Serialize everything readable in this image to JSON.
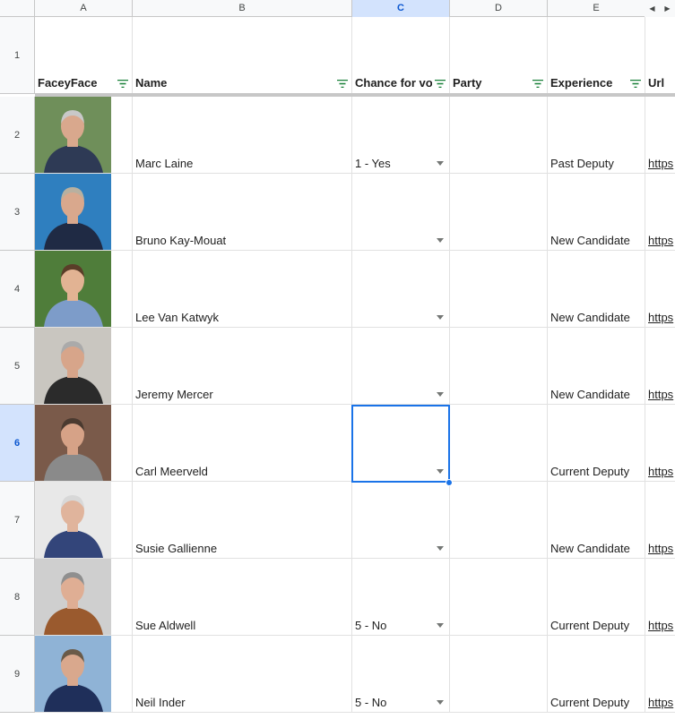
{
  "columns": [
    "A",
    "B",
    "C",
    "D",
    "E",
    ""
  ],
  "selected_column": "C",
  "selected_row": "6",
  "header_row": {
    "number": "1",
    "cells": [
      "FaceyFace",
      "Name",
      "Chance for vo",
      "Party",
      "Experience",
      "Url"
    ]
  },
  "rows": [
    {
      "number": "2",
      "name": "Marc Laine",
      "chance": "1 - Yes",
      "party": "",
      "experience": "Past Deputy",
      "url": "https",
      "photo_bg": "#6f8f5a",
      "photo_skin": "#d9a88d",
      "photo_clothes": "#2e3a55",
      "photo_hair": "#c8c8c8"
    },
    {
      "number": "3",
      "name": "Bruno Kay-Mouat",
      "chance": "",
      "party": "",
      "experience": "New Candidate",
      "url": "https",
      "photo_bg": "#2f7fbf",
      "photo_skin": "#d9a88d",
      "photo_clothes": "#1f2a44",
      "photo_hair": "#b8b0a0"
    },
    {
      "number": "4",
      "name": "Lee Van Katwyk",
      "chance": "",
      "party": "",
      "experience": "New Candidate",
      "url": "https",
      "photo_bg": "#4f7d3a",
      "photo_skin": "#e2b393",
      "photo_clothes": "#7d9cc9",
      "photo_hair": "#5a3d28"
    },
    {
      "number": "5",
      "name": "Jeremy Mercer",
      "chance": "",
      "party": "",
      "experience": "New Candidate",
      "url": "https",
      "photo_bg": "#c9c6c0",
      "photo_skin": "#d7a58a",
      "photo_clothes": "#2b2b2b",
      "photo_hair": "#aaaaaa"
    },
    {
      "number": "6",
      "name": "Carl Meerveld",
      "chance": "",
      "party": "",
      "experience": "Current Deputy",
      "url": "https",
      "photo_bg": "#7a5a4a",
      "photo_skin": "#d6a287",
      "photo_clothes": "#8a8a8a",
      "photo_hair": "#4a3a30"
    },
    {
      "number": "7",
      "name": "Susie Gallienne",
      "chance": "",
      "party": "",
      "experience": "New Candidate",
      "url": "https",
      "photo_bg": "#e8e8e8",
      "photo_skin": "#e0b49c",
      "photo_clothes": "#33457a",
      "photo_hair": "#d8d8d8"
    },
    {
      "number": "8",
      "name": "Sue Aldwell",
      "chance": "5 - No",
      "party": "",
      "experience": "Current Deputy",
      "url": "https",
      "photo_bg": "#cfcfcf",
      "photo_skin": "#dfae94",
      "photo_clothes": "#9a5a2e",
      "photo_hair": "#8f8f8f"
    },
    {
      "number": "9",
      "name": "Neil Inder",
      "chance": "5 - No",
      "party": "",
      "experience": "Current Deputy",
      "url": "https",
      "photo_bg": "#8fb3d6",
      "photo_skin": "#d9a88d",
      "photo_clothes": "#1f2f5a",
      "photo_hair": "#6a5a48"
    }
  ],
  "colors": {
    "selection": "#1a73e8",
    "link": "#0b57d0",
    "filter_icon": "#188038",
    "header_bg": "#f8f9fa"
  }
}
